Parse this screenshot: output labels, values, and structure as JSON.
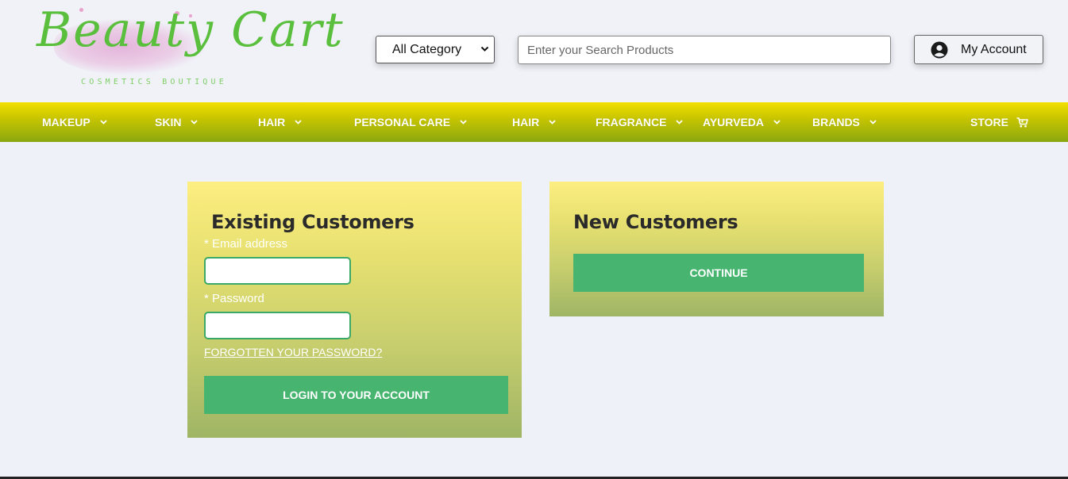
{
  "logo": {
    "title": "Beauty Cart",
    "subtitle": "COSMETICS BOUTIQUE"
  },
  "search": {
    "category_selected": "All Category",
    "placeholder": "Enter your Search Products"
  },
  "account": {
    "label": "My Account"
  },
  "nav": {
    "items": [
      {
        "label": "MAKEUP"
      },
      {
        "label": "SKIN"
      },
      {
        "label": "HAIR"
      },
      {
        "label": "PERSONAL CARE"
      },
      {
        "label": "HAIR"
      },
      {
        "label": "FRAGRANCE"
      },
      {
        "label": "AYURVEDA"
      },
      {
        "label": "BRANDS"
      }
    ],
    "store_label": "STORE"
  },
  "existing": {
    "title": "Existing Customers",
    "email_label": "* Email address",
    "email_value": "",
    "password_label": "* Password",
    "password_value": "",
    "forgot_link": "FORGOTTEN YOUR PASSWORD?",
    "login_button": "LOGIN TO YOUR ACCOUNT"
  },
  "new_customers": {
    "title": "New Customers",
    "continue_button": "CONTINUE"
  },
  "colors": {
    "brand_green": "#5bbf3e",
    "button_green": "#47b570",
    "nav_top": "#f2e000",
    "nav_bottom": "#8aa810",
    "panel_top": "#fdee80",
    "panel_bottom": "#9fb565"
  },
  "icons": {
    "account": "user-circle-icon",
    "dropdown": "chevron-down-icon",
    "store": "cart-icon"
  }
}
